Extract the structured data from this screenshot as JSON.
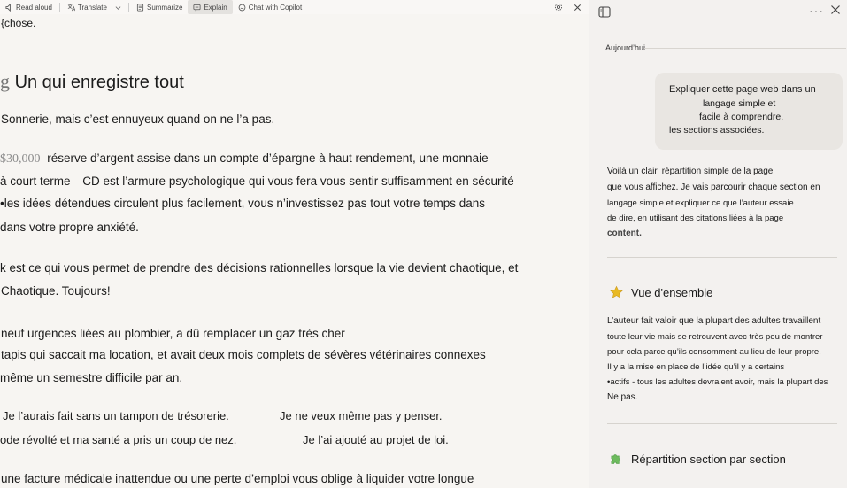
{
  "toolbar": {
    "items": [
      {
        "label": "Read aloud",
        "icon": "read-aloud-icon"
      },
      {
        "label": "Translate",
        "icon": "translate-icon"
      },
      {
        "label": "Summarize",
        "icon": "summarize-icon"
      },
      {
        "label": "Explain",
        "icon": "explain-icon",
        "active": true
      },
      {
        "label": "Chat with Copilot",
        "icon": "copilot-icon"
      }
    ]
  },
  "reader": {
    "line1": "{chose.",
    "heading": "Un qui enregistre tout",
    "heading_mark": "g",
    "p1": "Sonnerie, mais c’est ennuyeux quand on ne l’a pas.",
    "p2_amount": "$30,000",
    "p2_l1": "réserve d’argent assise dans un compte d’épargne à haut rendement, une monnaie",
    "p2_l2a": "à court terme",
    "p2_l2b": "CD est l’armure psychologique qui vous fera vous sentir suffisamment en sécurité",
    "p2_l3": "•les idées détendues circulent plus facilement, vous n’investissez pas tout votre temps dans",
    "p2_l4": "dans votre propre anxiété.",
    "p3_l1": "k est ce qui vous permet de prendre des décisions rationnelles lorsque la vie devient chaotique, et",
    "p3_l2": "Chaotique. Toujours!",
    "p4_l1": "neuf urgences liées au plombier, a dû remplacer un gaz très cher",
    "p4_l2": "tapis qui saccait ma location, et avait deux mois complets de sévères vétérinaires connexes",
    "p4_l3": "même un semestre difficile par an.",
    "p5_l1a": "Je l’aurais fait sans un tampon de trésorerie.",
    "p5_l1b": "Je ne veux même pas y penser.",
    "p5_l2a": "ode révolté et ma santé a pris un coup de nez.",
    "p5_l2b": "Je l’ai ajouté au projet de loi.",
    "p6_l1": "une facture médicale inattendue ou une perte d’emploi vous oblige à liquider votre longue"
  },
  "sidebar": {
    "today_label": "Aujourd’hui",
    "user_message": [
      "Expliquer cette page web dans un",
      "langage simple et",
      "facile à comprendre.",
      "les sections associées."
    ],
    "response": [
      "Voilà un clair. répartition simple de la page",
      "que vous affichez. Je vais parcourir chaque section en",
      "langage simple et expliquer ce que l’auteur essaie",
      "de dire, en utilisant des citations liées à la page",
      "content."
    ],
    "overview_title": "Vue d'ensemble",
    "overview_text": [
      "L’auteur fait valoir que la plupart des adultes travaillent",
      "toute leur vie mais se retrouvent avec très peu de montrer",
      "pour cela parce qu’ils consomment au lieu de leur propre.",
      "Il y a la mise en place de l’idée qu’il y a certains",
      "•actifs - tous les adultes devraient avoir, mais la plupart des",
      "Ne pas."
    ],
    "breakdown_title": "Répartition section par section",
    "colors": {
      "star": "#e8b923",
      "puzzle": "#6dbb5e"
    }
  }
}
